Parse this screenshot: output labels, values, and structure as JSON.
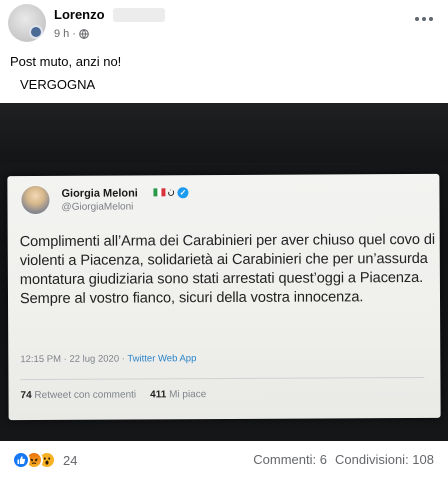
{
  "post": {
    "author": "Lorenzo",
    "time": "9 h",
    "text_line1": "Post muto, anzi no!",
    "text_line2": "VERGOGNA"
  },
  "tweet": {
    "name": "Giorgia Meloni",
    "handle": "@GiorgiaMeloni",
    "extra_glyph": "ن",
    "text": "Complimenti all’Arma dei Carabinieri per aver chiuso quel covo di violenti a Piacenza, solidarietà ai Carabinieri che per un’assurda montatura giudiziaria sono stati arrestati quest’oggi a Piacenza. Sempre al vostro fianco, sicuri della vostra innocenza.",
    "datetime": "12:15 PM · 22 lug 2020 · ",
    "app": "Twitter Web App",
    "retweets_count": "74",
    "retweets_label": "Retweet con commenti",
    "likes_count": "411",
    "likes_label": "Mi piace"
  },
  "footer": {
    "reactions_count": "24",
    "comments": "Commenti: 6",
    "shares": "Condivisioni: 108"
  },
  "colors": {
    "facebook_blue": "#1877f2",
    "twitter_blue": "#1d9bf0",
    "meta_gray": "#65676b"
  },
  "icons": [
    "globe-icon",
    "more-icon",
    "verified-icon",
    "italy-flag-icon",
    "like-icon",
    "angry-icon",
    "wow-icon"
  ]
}
